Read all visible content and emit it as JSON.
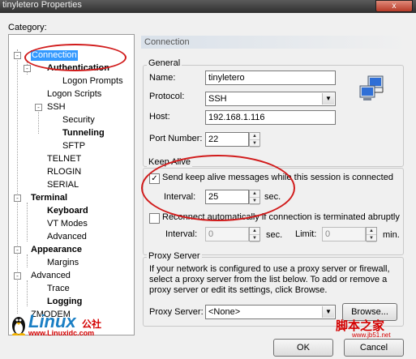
{
  "window": {
    "title": "tinyletero Properties",
    "close_glyph": "x"
  },
  "category_label": "Category:",
  "tree": {
    "expander_minus": "-",
    "items": [
      {
        "label": "Connection"
      },
      {
        "label": "Authentication"
      },
      {
        "label": "Logon Prompts"
      },
      {
        "label": "Logon Scripts"
      },
      {
        "label": "SSH"
      },
      {
        "label": "Security"
      },
      {
        "label": "Tunneling"
      },
      {
        "label": "SFTP"
      },
      {
        "label": "TELNET"
      },
      {
        "label": "RLOGIN"
      },
      {
        "label": "SERIAL"
      },
      {
        "label": "Terminal"
      },
      {
        "label": "Keyboard"
      },
      {
        "label": "VT Modes"
      },
      {
        "label": "Advanced"
      },
      {
        "label": "Appearance"
      },
      {
        "label": "Margins"
      },
      {
        "label": "Advanced"
      },
      {
        "label": "Trace"
      },
      {
        "label": "Logging"
      },
      {
        "label": "ZMODEM"
      }
    ]
  },
  "panel_title": "Connection",
  "general": {
    "title": "General",
    "name_label": "Name:",
    "name_value": "tinyletero",
    "protocol_label": "Protocol:",
    "protocol_value": "SSH",
    "host_label": "Host:",
    "host_value": "192.168.1.116",
    "port_label": "Port Number:",
    "port_value": "22",
    "network_icon": "network-computers-icon"
  },
  "keepalive": {
    "title": "Keep Alive",
    "send_label": "Send keep alive messages while this session is connected",
    "send_checked": true,
    "interval_label": "Interval:",
    "interval_value": "25",
    "interval_unit": "sec.",
    "reconnect_label": "Reconnect automatically if connection is terminated abruptly",
    "reconnect_checked": false,
    "re_interval_label": "Interval:",
    "re_interval_value": "0",
    "re_interval_unit": "sec.",
    "limit_label": "Limit:",
    "limit_value": "0",
    "limit_unit": "min."
  },
  "proxy": {
    "title": "Proxy Server",
    "description": "If your network is configured to use a proxy server or firewall, select a proxy server from the list below. To add or remove a proxy server or edit its settings, click Browse.",
    "server_label": "Proxy Server:",
    "server_value": "<None>",
    "browse_label": "Browse..."
  },
  "buttons": {
    "ok": "OK",
    "cancel": "Cancel"
  },
  "watermarks": {
    "linux_logo": "Linux",
    "linux_cn": "公社",
    "linux_url": "www.Linuxidc.com",
    "jb51_name": "脚本之家",
    "jb51_url": "www.jb51.net"
  },
  "checkmark": "✓",
  "dropdown_arrow": "▼",
  "spin_up": "▲",
  "spin_down": "▼"
}
